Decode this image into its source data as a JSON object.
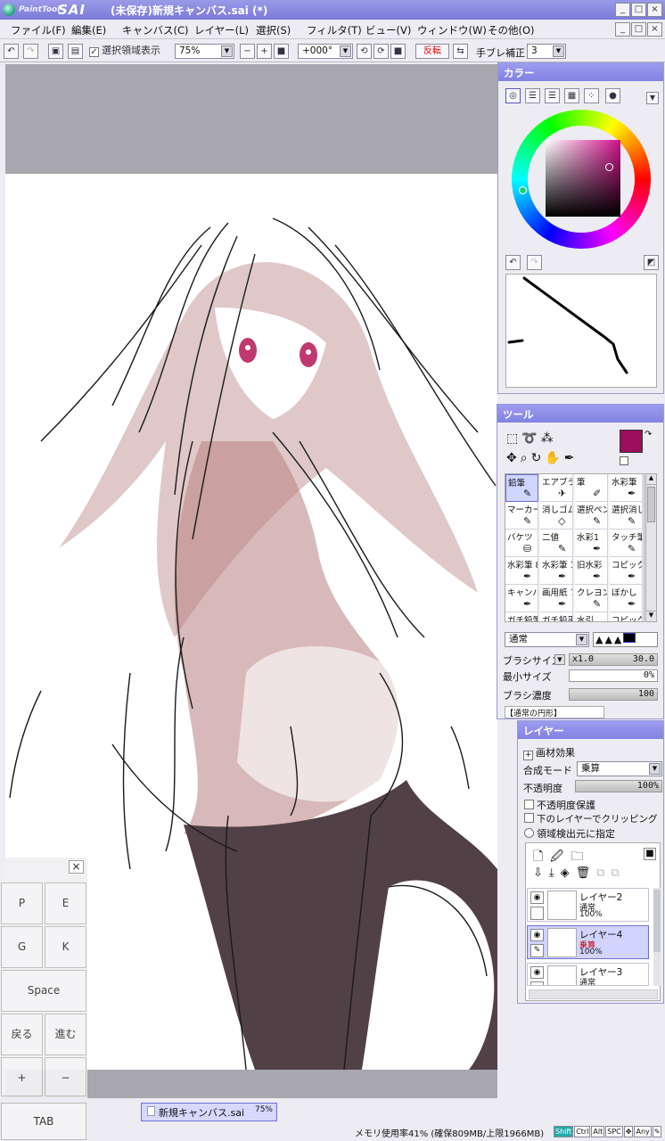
{
  "window": {
    "app_logo_small": "PaintTool",
    "app_logo_big": "SAI",
    "title": "(未保存)新規キャンバス.sai (*)",
    "controls": [
      "_",
      "□",
      "×"
    ]
  },
  "menu": [
    "ファイル(F)",
    "編集(E)",
    "キャンバス(C)",
    "レイヤー(L)",
    "選択(S)",
    "フィルタ(T)",
    "ビュー(V)",
    "ウィンドウ(W)",
    "その他(O)"
  ],
  "toolbar": {
    "show_selection_label": "選択領域表示",
    "show_selection_checked": true,
    "zoom": "75%",
    "rotation": "+000°",
    "flip_label": "反転",
    "stabilizer_label": "手ブレ補正",
    "stabilizer_value": "3"
  },
  "color_panel": {
    "title": "カラー",
    "current_color": "#9b0f5e",
    "secondary_color": "#ffffff"
  },
  "tool_panel": {
    "title": "ツール",
    "brushes": [
      [
        "鉛筆",
        "エアブラシ",
        "筆",
        "水彩筆"
      ],
      [
        "マーカー",
        "消しゴム",
        "選択ペン",
        "選択消し"
      ],
      [
        "バケツ",
        "二値",
        "水彩1",
        "タッチ筆"
      ],
      [
        "水彩筆 8版",
        "水彩筆 10版",
        "旧水彩",
        "コピック"
      ],
      [
        "キャンバス アクリル",
        "画用紙 アクリル",
        "クレヨン",
        "ぼかし"
      ],
      [
        "ガチ鉛筆",
        "ガチ鉛平",
        "水引",
        "コピック筆"
      ]
    ],
    "blend_mode": "通常",
    "brush_size_label": "ブラシサイズ",
    "brush_size_multiplier": "x1.0",
    "brush_size_value": "30.0",
    "min_size_label": "最小サイズ",
    "min_size_value": "0%",
    "brush_density_label": "ブラシ濃度",
    "brush_density_value": "100",
    "next_row_label": "【通常の円形】"
  },
  "layer_panel": {
    "title": "レイヤー",
    "texture_effect": "画材効果",
    "blend_label": "合成モード",
    "blend_value": "乗算",
    "opacity_label": "不透明度",
    "opacity_value": "100%",
    "protect_opacity": "不透明度保護",
    "clip_label": "下のレイヤーでクリッピング",
    "selection_source": "領域検出元に指定",
    "layers": [
      {
        "name": "レイヤー2",
        "mode": "通常",
        "opacity": "100%",
        "selected": false
      },
      {
        "name": "レイヤー4",
        "mode": "乗算",
        "opacity": "100%",
        "selected": true
      },
      {
        "name": "レイヤー3",
        "mode": "通常",
        "opacity": "",
        "selected": false
      }
    ]
  },
  "keypad": {
    "close": "×",
    "keys": [
      "P",
      "E",
      "G",
      "K",
      "Space",
      "戻る",
      "進む",
      "+",
      "−",
      "TAB"
    ]
  },
  "status": {
    "tabs": [
      {
        "name": "新規キャンバス.sai",
        "zoom": "75%"
      },
      {
        "name": "新規キャンバス.sai",
        "zoom": "75%"
      }
    ],
    "memory": "メモリ使用率41% (確保809MB/上限1966MB)",
    "indicators": [
      "Shift",
      "Ctrl",
      "Alt",
      "SPC",
      "✥",
      "Any",
      "✎"
    ]
  }
}
